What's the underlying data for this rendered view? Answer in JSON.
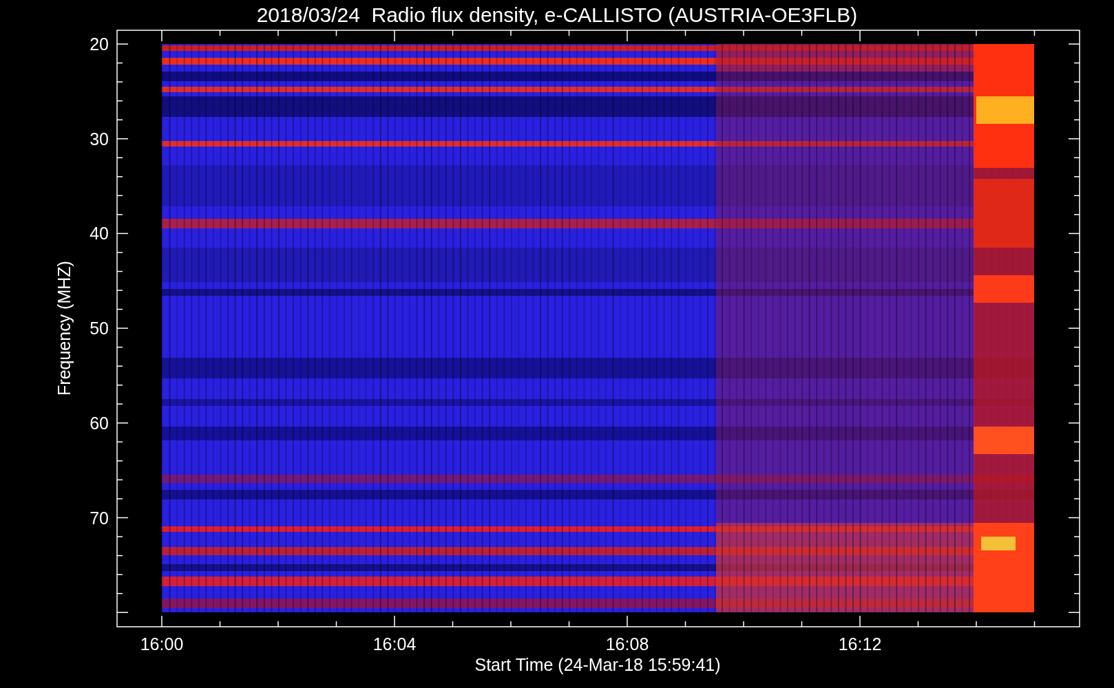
{
  "title": "2018/03/24  Radio flux density, e-CALLISTO (AUSTRIA-OE3FLB)",
  "y_axis": {
    "label": "Frequency (MHZ)",
    "ticks": [
      "20",
      "30",
      "40",
      "50",
      "60",
      "70"
    ]
  },
  "x_axis": {
    "label": "Start Time (24-Mar-18 15:59:41)",
    "ticks": [
      "16:00",
      "16:04",
      "16:08",
      "16:12"
    ]
  }
}
